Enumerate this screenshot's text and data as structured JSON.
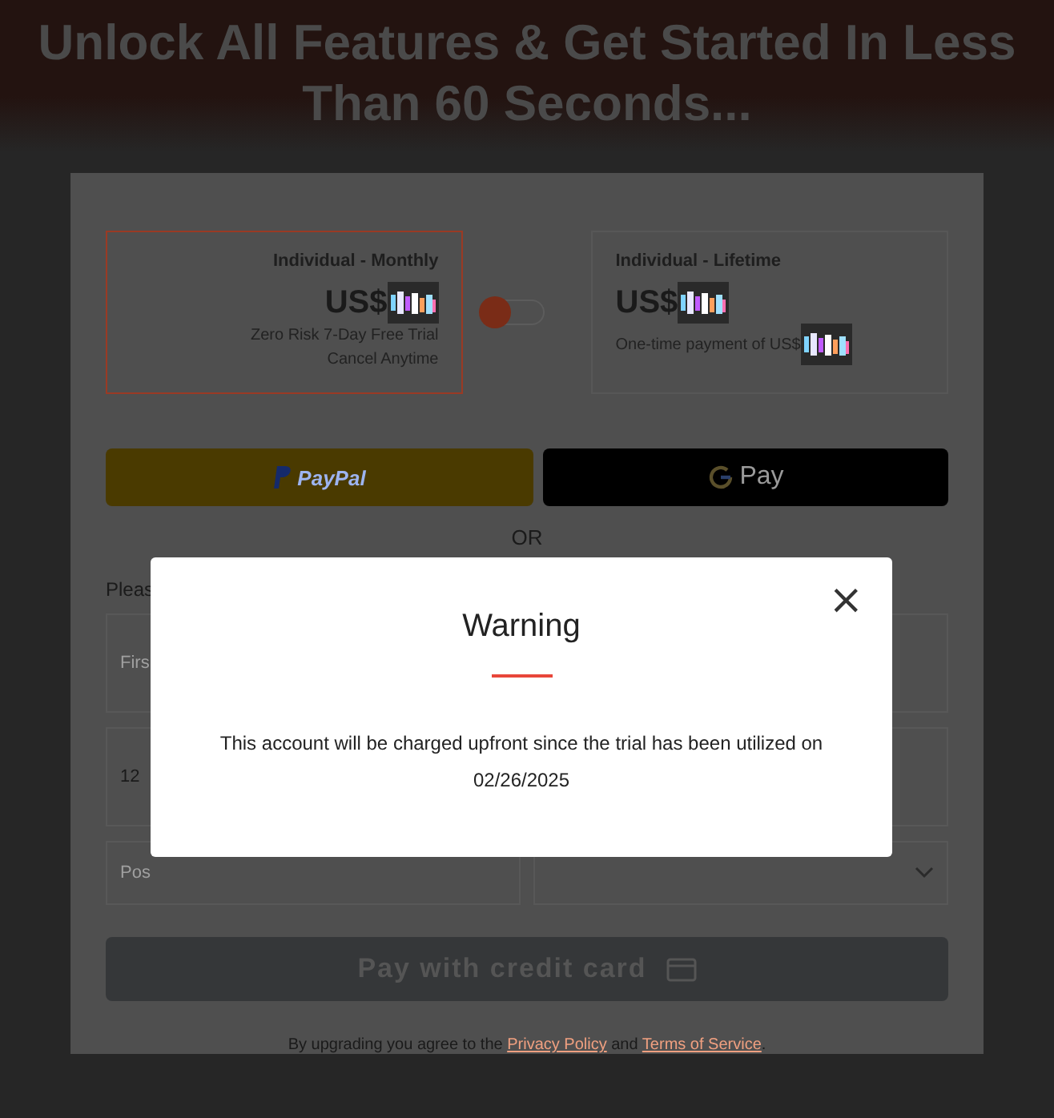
{
  "headline": "Unlock All Features & Get Started In Less Than 60 Seconds...",
  "plans": [
    {
      "name": "Individual - Monthly",
      "currency": "US$",
      "notes": [
        "Zero Risk 7-Day Free Trial",
        "Cancel Anytime"
      ],
      "selected": true
    },
    {
      "name": "Individual - Lifetime",
      "currency": "US$",
      "notes": [
        "One-time payment of US$"
      ],
      "selected": false
    }
  ],
  "payment_buttons": [
    {
      "kind": "paypal",
      "label": "PayPal"
    },
    {
      "kind": "gpay",
      "label": "Pay"
    }
  ],
  "divider": "OR",
  "form": {
    "intro": "Pleas",
    "fields": [
      {
        "kind": "text",
        "placeholder": "Firs"
      },
      {
        "kind": "value",
        "value": "12"
      },
      {
        "kind": "split",
        "placeholder": "Pos"
      }
    ],
    "submit": "Pay with credit card",
    "footer": {
      "before": "By upgrading you agree to the",
      "link1": "Privacy Policy",
      "middle": "and",
      "link2": "Terms of Service",
      "after": "."
    }
  },
  "modal": {
    "title": "Warning",
    "close": "×",
    "message": "This account will be charged upfront since the trial has been utilized on 02/26/2025"
  }
}
